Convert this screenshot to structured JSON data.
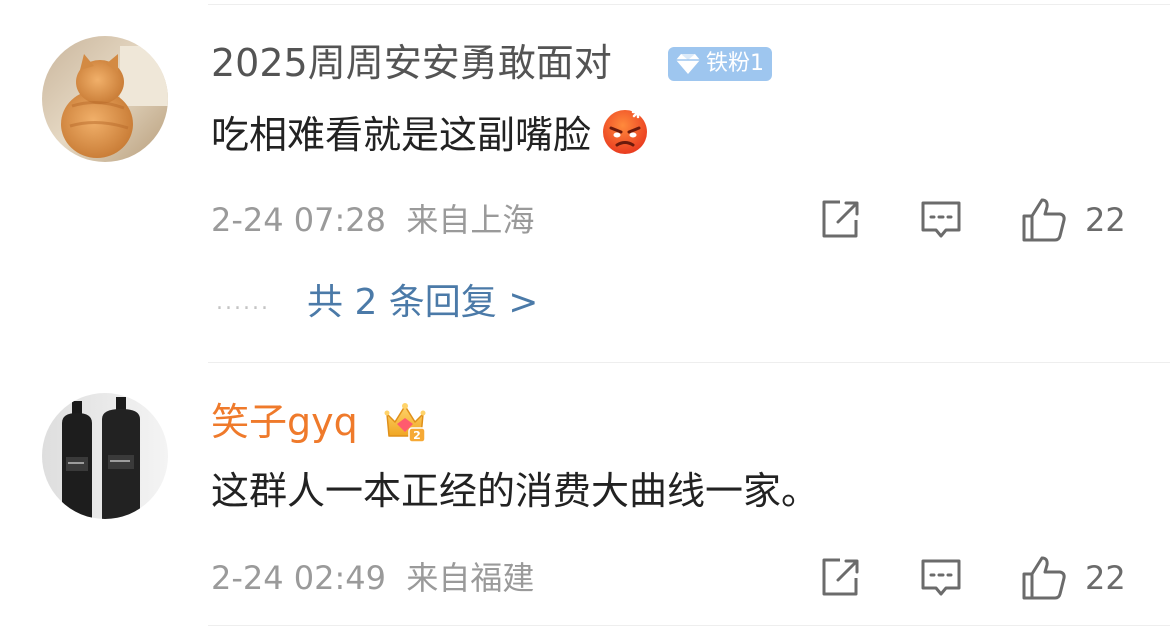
{
  "comments": [
    {
      "avatar_icon": "cat-photo-avatar",
      "username": "2025周周安安勇敢面对",
      "badge": {
        "icon": "diamond-icon",
        "label": "铁粉1",
        "color": "#9ec6ef"
      },
      "text": "吃相难看就是这副嘴脸",
      "emoji": "angry-face-emoji",
      "timestamp": "2-24 07:28",
      "location": "来自上海",
      "like_count": "22",
      "replies": {
        "dots": "......",
        "label": "共 2 条回复 >"
      }
    },
    {
      "avatar_icon": "bottles-photo-avatar",
      "username": "笑子gyq",
      "username_color": "#ef7a2b",
      "badge": {
        "icon": "crown-icon"
      },
      "text": "这群人一本正经的消费大曲线一家。",
      "timestamp": "2-24 02:49",
      "location": "来自福建",
      "like_count": "22"
    }
  ],
  "colors": {
    "meta_gray": "#9a9a9a",
    "link_blue": "#4b7aa8",
    "divider": "#eeeeee"
  }
}
